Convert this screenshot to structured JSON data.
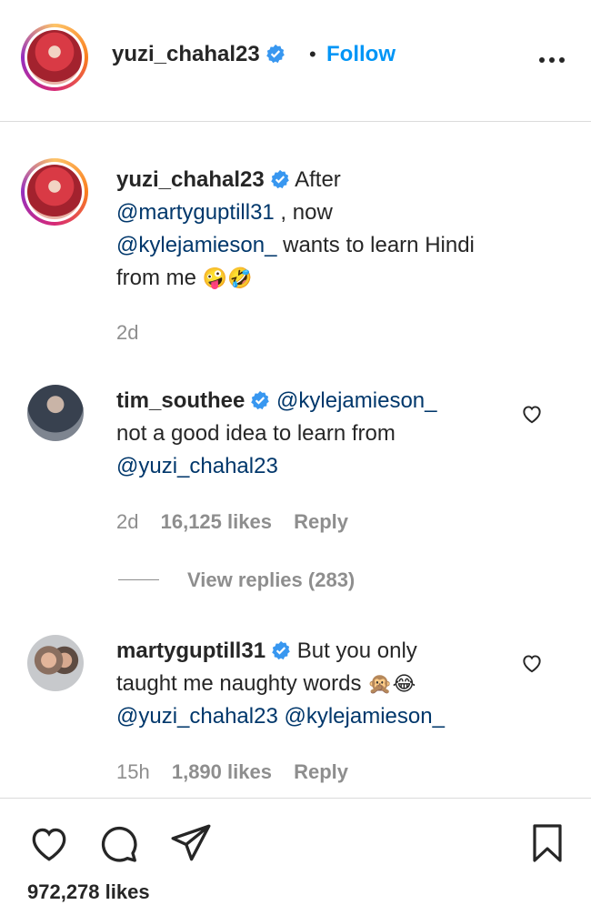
{
  "header": {
    "username": "yuzi_chahal23",
    "separator": "•",
    "follow_label": "Follow",
    "more_icon": "more-horizontal-icon"
  },
  "caption": {
    "username": "yuzi_chahal23",
    "text_1": "After",
    "mention_1": "@martyguptill31",
    "text_2": " , now",
    "mention_2": "@kylejamieson_",
    "text_3": " wants to learn Hindi",
    "text_4": "from me ",
    "emojis": "🤪🤣",
    "time": "2d"
  },
  "comments": [
    {
      "username": "tim_southee",
      "mention_1": "@kylejamieson_",
      "text": "not a good idea to learn from",
      "mention_2": "@yuzi_chahal23",
      "time": "2d",
      "likes": "16,125 likes",
      "reply_label": "Reply",
      "view_replies": "View replies (283)"
    },
    {
      "username": "martyguptill31",
      "text_1": "But you only",
      "text_2": "taught me naughty words ",
      "emojis": "🙊😂",
      "mention_1": "@yuzi_chahal23",
      "mention_2": "@kylejamieson_",
      "time": "15h",
      "likes": "1,890 likes",
      "reply_label": "Reply"
    }
  ],
  "footer": {
    "likes": "972,278 likes",
    "icons": [
      "heart-icon",
      "comment-icon",
      "share-icon",
      "bookmark-icon"
    ]
  },
  "colors": {
    "link": "#00376b",
    "follow": "#0095f6",
    "verified": "#3897f0",
    "muted": "#8e8e8e"
  }
}
